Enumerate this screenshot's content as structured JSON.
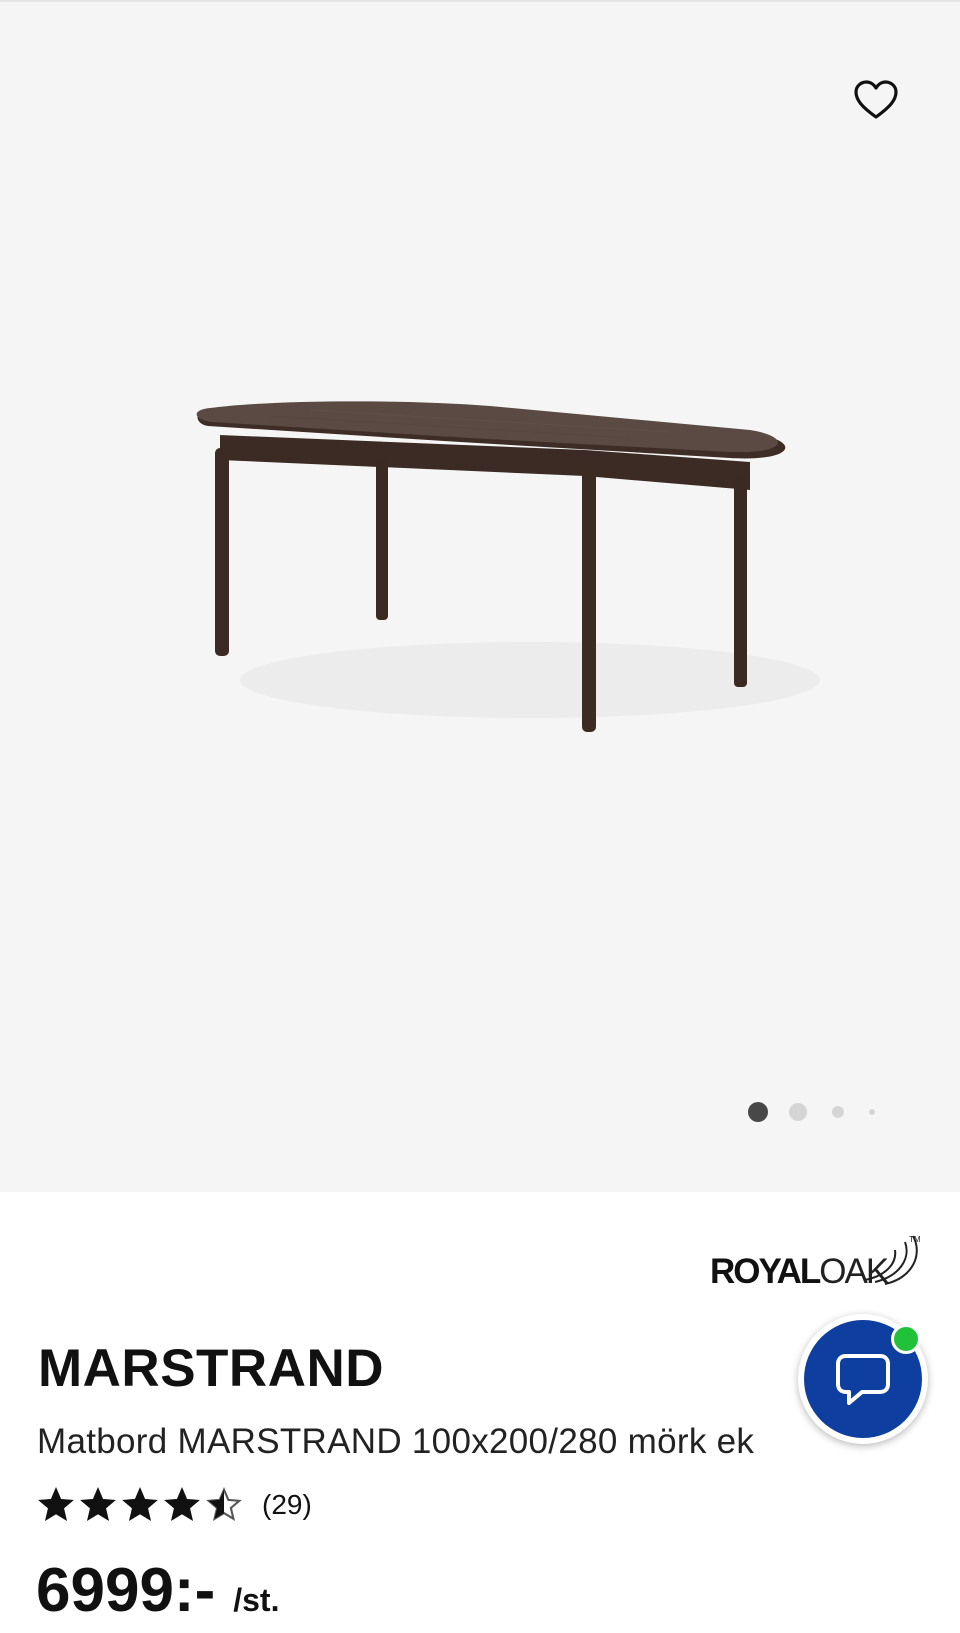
{
  "gallery": {
    "image_alt": "Matbord MARSTRAND 100x200/280 mörk ek",
    "slide_count": 4,
    "active_slide": 1,
    "favorite_icon": "heart-outline-icon",
    "background_color": "#f5f5f5"
  },
  "brand": {
    "name_bold": "ROYAL",
    "name_light": "OAK",
    "trademark": "TM"
  },
  "product": {
    "name": "MARSTRAND",
    "description": "Matbord MARSTRAND 100x200/280 mörk ek",
    "rating": 4.5,
    "rating_max": 5,
    "rating_count": "(29)",
    "price": "6999:-",
    "price_unit": "/st."
  },
  "chat": {
    "icon": "speech-bubble-icon",
    "status": "online",
    "button_color": "#0e3fa0",
    "status_color": "#21c23a"
  }
}
